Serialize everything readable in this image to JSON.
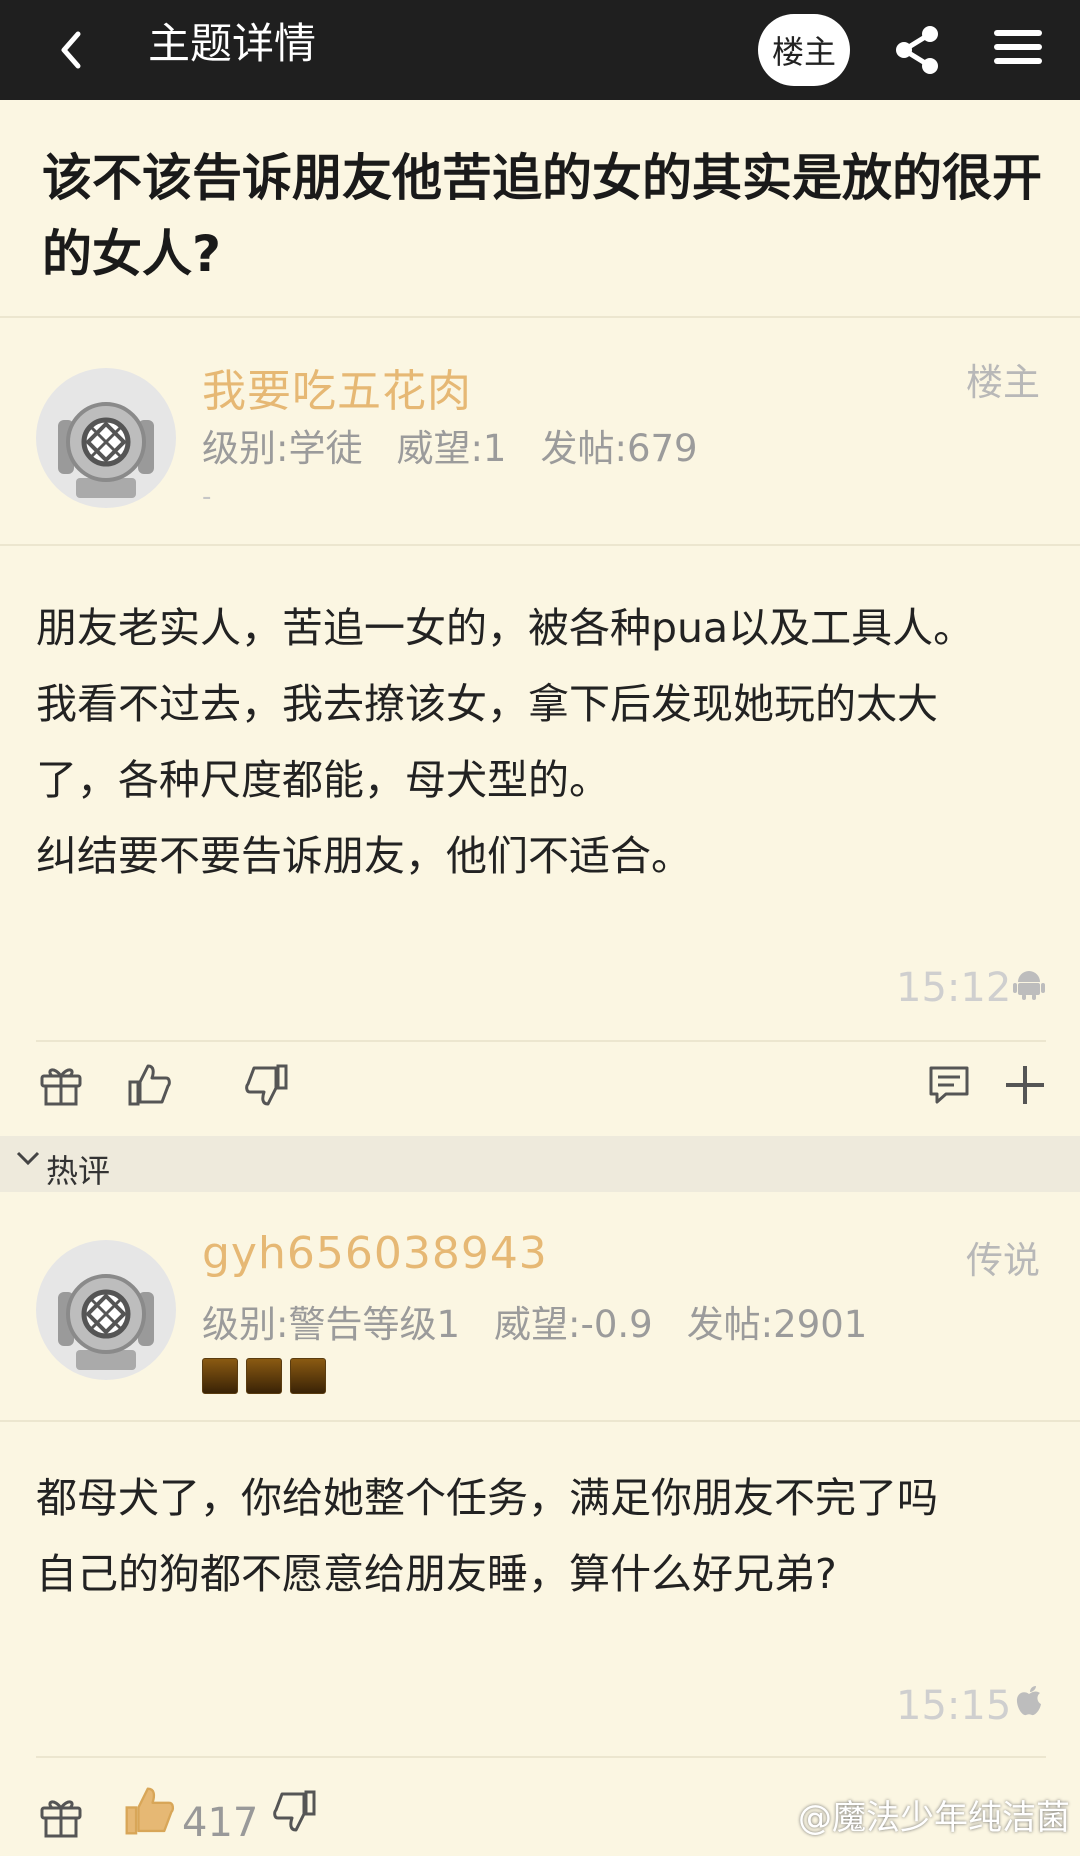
{
  "header": {
    "title": "主题详情",
    "op_pill": "楼主"
  },
  "thread": {
    "title": "该不该告诉朋友他苦追的女的其实是放的很开的女人?"
  },
  "op_post": {
    "username": "我要吃五花肉",
    "level": "级别:学徒",
    "prestige": "威望:1",
    "posts": "发帖:679",
    "role": "楼主",
    "extra": "-",
    "lines": [
      "朋友老实人，苦追一女的，被各种pua以及工具人。",
      "我看不过去，我去撩该女，拿下后发现她玩的太大",
      "了，各种尺度都能，母犬型的。",
      "纠结要不要告诉朋友，他们不适合。"
    ],
    "time": "15:12",
    "device_icon": "android-icon"
  },
  "hot_section": {
    "label": "热评"
  },
  "reply": {
    "username": "gyh656038943",
    "level": "级别:警告等级1",
    "prestige": "威望:-0.9",
    "posts": "发帖:2901",
    "role": "传说",
    "lines": [
      "都母犬了，你给她整个任务，满足你朋友不完了吗",
      "自己的狗都不愿意给朋友睡，算什么好兄弟?"
    ],
    "time": "15:15",
    "device_icon": "apple-icon",
    "like_count": "417"
  },
  "watermark": "@魔法少年纯洁菌",
  "colors": {
    "topbar": "#1f1f1f",
    "background": "#fbf6e2",
    "username": "#e6b874",
    "meta": "#9b9b9b"
  }
}
